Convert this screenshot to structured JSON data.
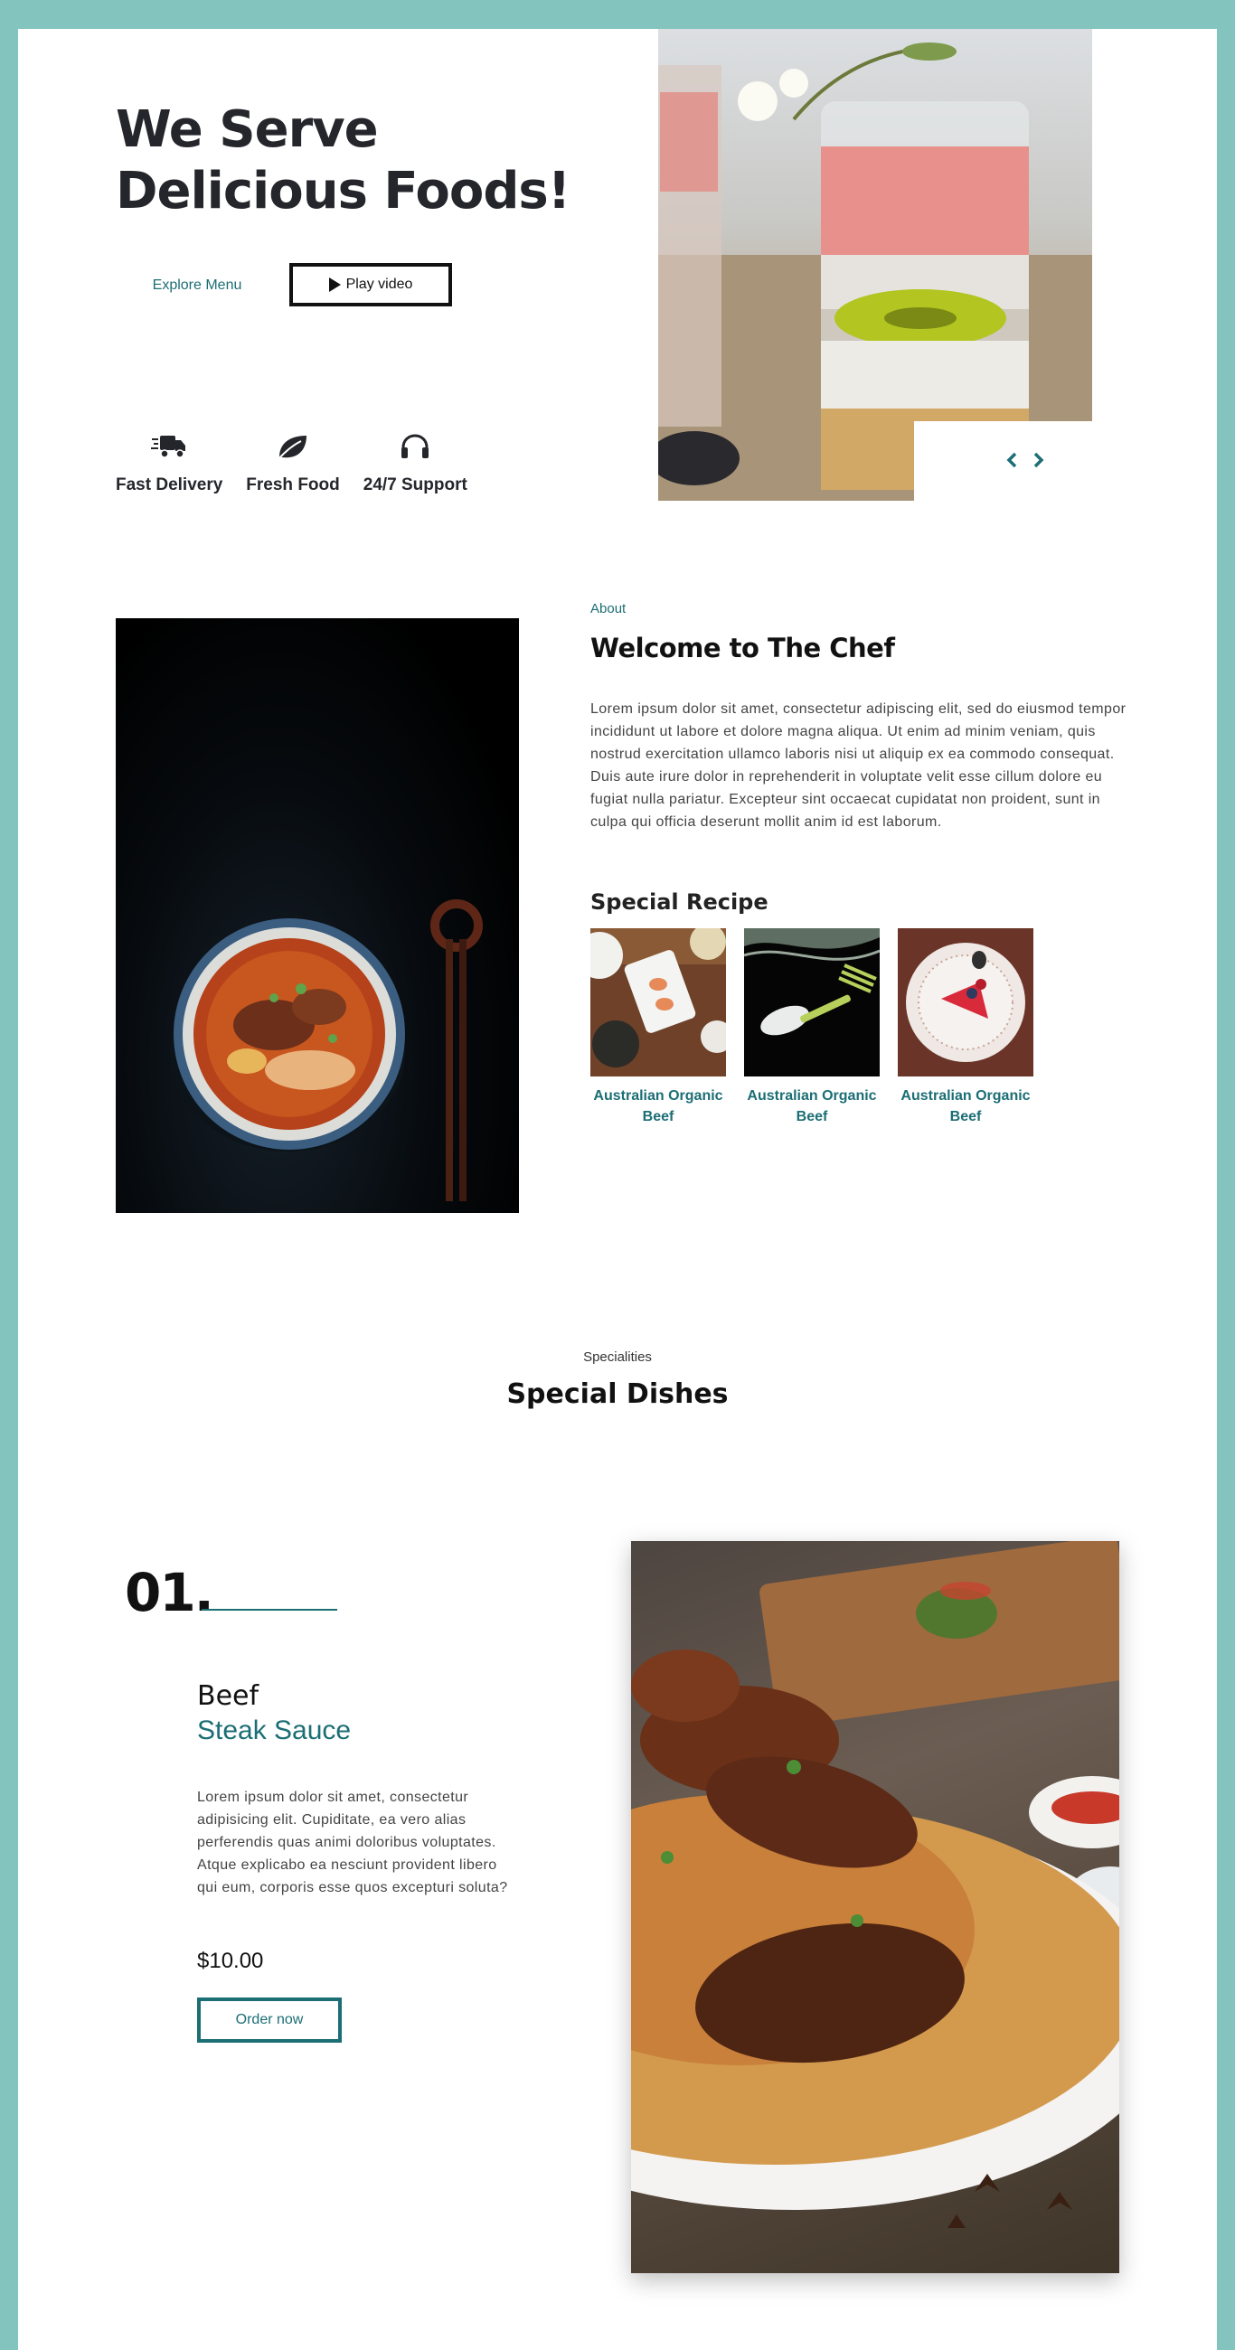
{
  "hero": {
    "title_line1": "We Serve",
    "title_line2": "Delicious Foods!",
    "explore_label": "Explore Menu",
    "play_label": "Play video",
    "features": [
      {
        "icon": "truck-icon",
        "label": "Fast Delivery"
      },
      {
        "icon": "leaf-icon",
        "label": "Fresh Food"
      },
      {
        "icon": "headphones-icon",
        "label": "24/7 Support"
      }
    ]
  },
  "about": {
    "kicker": "About",
    "title": "Welcome to The Chef",
    "text": "Lorem ipsum dolor sit amet, consectetur adipiscing elit, sed do eiusmod tempor incididunt ut labore et dolore magna aliqua. Ut enim ad minim veniam, quis nostrud exercitation ullamco laboris nisi ut aliquip ex ea commodo consequat. Duis aute irure dolor in reprehenderit in voluptate velit esse cillum dolore eu fugiat nulla pariatur. Excepteur sint occaecat cupidatat non proident, sunt in culpa qui officia deserunt mollit anim id est laborum.",
    "special_title": "Special Recipe",
    "recipes": [
      {
        "name": "Australian Organic Beef"
      },
      {
        "name": "Australian Organic Beef"
      },
      {
        "name": "Australian Organic Beef"
      }
    ]
  },
  "specialities": {
    "kicker": "Specialities",
    "title": "Special Dishes"
  },
  "dish": {
    "number": "01.",
    "name_line1": "Beef",
    "name_line2": "Steak Sauce",
    "description": "Lorem ipsum dolor sit amet, consectetur adipisicing elit. Cupiditate, ea vero alias perferendis quas animi doloribus voluptates. Atque explicabo ea nesciunt provident libero qui eum, corporis esse quos excepturi soluta?",
    "price": "$10.00",
    "order_label": "Order now"
  },
  "colors": {
    "frame": "#83c5be",
    "accent": "#1c6e75",
    "heading": "#25262b"
  }
}
